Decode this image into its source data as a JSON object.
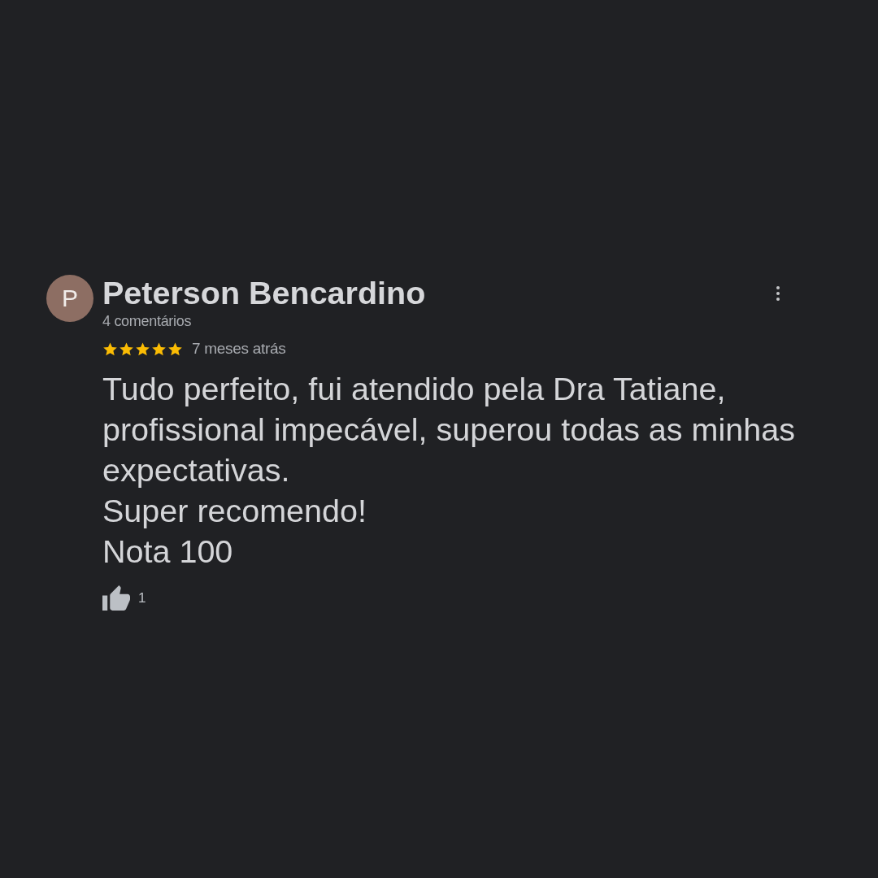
{
  "review": {
    "avatar_letter": "P",
    "author": "Peterson Bencardino",
    "author_meta": "4 comentários",
    "stars": 5,
    "time": "7 meses atrás",
    "text": "Tudo perfeito, fui atendido pela Dra Tatiane, profissional impecável, superou todas as minhas expectativas.\nSuper recomendo!\nNota 100",
    "like_count": "1"
  }
}
